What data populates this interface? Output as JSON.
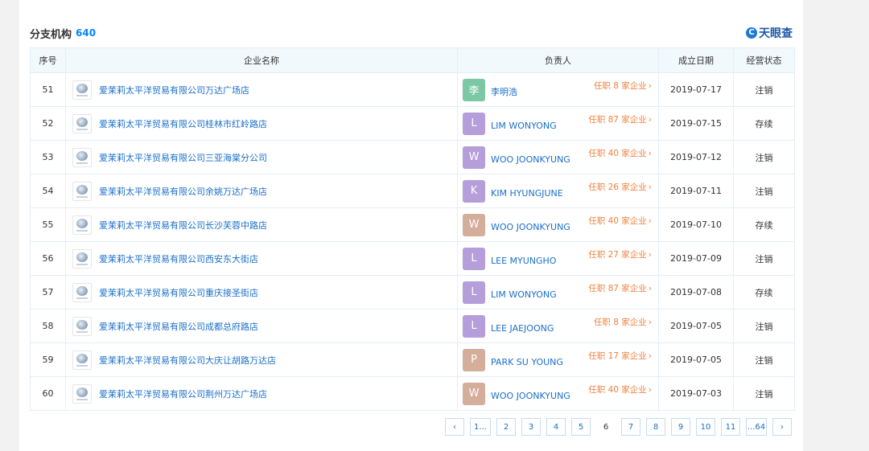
{
  "header": {
    "title": "分支机构",
    "count": "640",
    "brand_icon": "C",
    "brand_text": "天眼查"
  },
  "table": {
    "columns": [
      "序号",
      "企业名称",
      "负责人",
      "成立日期",
      "经营状态"
    ],
    "rows": [
      {
        "idx": "51",
        "company": "爱茉莉太平洋贸易有限公司万达广场店",
        "avatar": "李",
        "avatar_color": "#7dc8a4",
        "person": "李明浩",
        "tenure": "任职 8 家企业",
        "date": "2019-07-17",
        "status": "注销",
        "status_type": "cancel"
      },
      {
        "idx": "52",
        "company": "爱茉莉太平洋贸易有限公司桂林市红岭路店",
        "avatar": "L",
        "avatar_color": "#b59ed9",
        "person": "LIM WONYONG",
        "tenure": "任职 87 家企业",
        "date": "2019-07-15",
        "status": "存续",
        "status_type": "active"
      },
      {
        "idx": "53",
        "company": "爱茉莉太平洋贸易有限公司三亚海棠分公司",
        "avatar": "W",
        "avatar_color": "#b59ed9",
        "person": "WOO JOONKYUNG",
        "tenure": "任职 40 家企业",
        "date": "2019-07-12",
        "status": "注销",
        "status_type": "cancel"
      },
      {
        "idx": "54",
        "company": "爱茉莉太平洋贸易有限公司余姚万达广场店",
        "avatar": "K",
        "avatar_color": "#b59ed9",
        "person": "KIM HYUNGJUNE",
        "tenure": "任职 26 家企业",
        "date": "2019-07-11",
        "status": "注销",
        "status_type": "cancel"
      },
      {
        "idx": "55",
        "company": "爱茉莉太平洋贸易有限公司长沙芙蓉中路店",
        "avatar": "W",
        "avatar_color": "#d5ad9b",
        "person": "WOO JOONKYUNG",
        "tenure": "任职 40 家企业",
        "date": "2019-07-10",
        "status": "存续",
        "status_type": "active"
      },
      {
        "idx": "56",
        "company": "爱茉莉太平洋贸易有限公司西安东大街店",
        "avatar": "L",
        "avatar_color": "#b59ed9",
        "person": "LEE MYUNGHO",
        "tenure": "任职 27 家企业",
        "date": "2019-07-09",
        "status": "注销",
        "status_type": "cancel"
      },
      {
        "idx": "57",
        "company": "爱茉莉太平洋贸易有限公司重庆接圣街店",
        "avatar": "L",
        "avatar_color": "#b59ed9",
        "person": "LIM WONYONG",
        "tenure": "任职 87 家企业",
        "date": "2019-07-08",
        "status": "存续",
        "status_type": "active"
      },
      {
        "idx": "58",
        "company": "爱茉莉太平洋贸易有限公司成都总府路店",
        "avatar": "L",
        "avatar_color": "#b59ed9",
        "person": "LEE JAEJOONG",
        "tenure": "任职 8 家企业",
        "date": "2019-07-05",
        "status": "注销",
        "status_type": "cancel"
      },
      {
        "idx": "59",
        "company": "爱茉莉太平洋贸易有限公司大庆让胡路万达店",
        "avatar": "P",
        "avatar_color": "#d5ad9b",
        "person": "PARK SU YOUNG",
        "tenure": "任职 17 家企业",
        "date": "2019-07-05",
        "status": "注销",
        "status_type": "cancel"
      },
      {
        "idx": "60",
        "company": "爱茉莉太平洋贸易有限公司荆州万达广场店",
        "avatar": "W",
        "avatar_color": "#d5ad9b",
        "person": "WOO JOONKYUNG",
        "tenure": "任职 40 家企业",
        "date": "2019-07-03",
        "status": "注销",
        "status_type": "cancel"
      }
    ]
  },
  "colors": {
    "status_cancel": "#e2423e",
    "status_active": "#2ea44f",
    "link": "#1a6fc9",
    "tenure": "#f0803c"
  },
  "pagination": {
    "prev": "‹",
    "pages": [
      "1...",
      "2",
      "3",
      "4",
      "5",
      "6",
      "7",
      "8",
      "9",
      "10",
      "11",
      "...64"
    ],
    "current": "6",
    "next": "›"
  }
}
